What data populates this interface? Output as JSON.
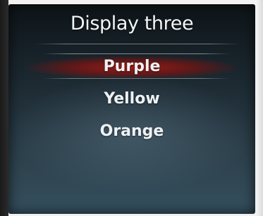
{
  "menu": {
    "title": "Display three",
    "items": [
      {
        "label": "Purple",
        "selected": true
      },
      {
        "label": "Yellow",
        "selected": false
      },
      {
        "label": "Orange",
        "selected": false
      }
    ]
  },
  "colors": {
    "selection": "#a01c16",
    "text": "#eef2f4",
    "background": "#1b2830"
  }
}
